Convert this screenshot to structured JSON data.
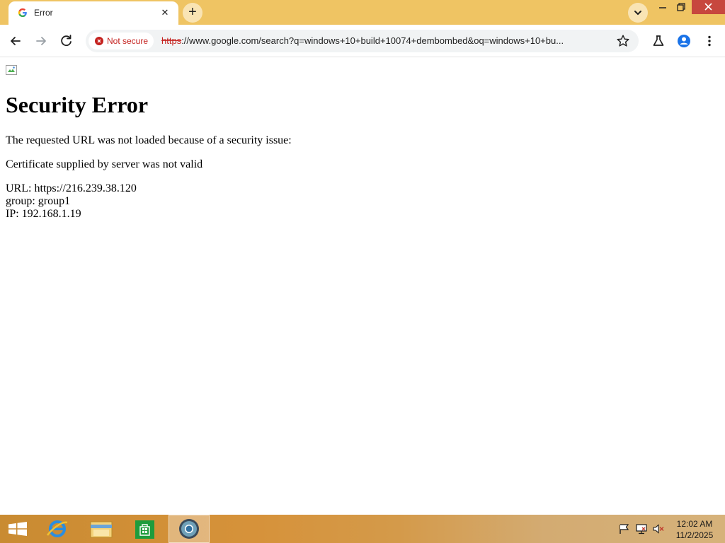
{
  "tab": {
    "title": "Error",
    "close_glyph": "✕"
  },
  "new_tab_glyph": "+",
  "omnibox": {
    "security_label": "Not secure",
    "url_scheme": "https",
    "url_rest": "://www.google.com/search?q=windows+10+build+10074+dembombed&oq=windows+10+bu..."
  },
  "page": {
    "title": "Security Error",
    "message": "The requested URL was not loaded because of a security issue:",
    "reason": "Certificate supplied by server was not valid",
    "url_line": "URL: https://216.239.38.120",
    "group_line": "group: group1",
    "ip_line": "IP: 192.168.1.19"
  },
  "taskbar": {
    "apps": [
      "start-icon",
      "internet-explorer-icon",
      "file-explorer-icon",
      "store-icon",
      "chrome-icon"
    ],
    "clock_time": "12:02 AM",
    "clock_date": "11/2/2025"
  },
  "colors": {
    "titlebar": "#efc463",
    "not_secure": "#c5221f",
    "close_button": "#c7473e",
    "profile": "#1a73e8"
  }
}
